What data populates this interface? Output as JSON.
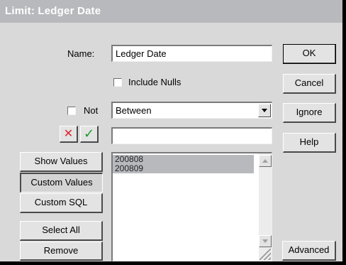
{
  "window": {
    "title": "Limit: Ledger Date"
  },
  "form": {
    "name_label": "Name:",
    "name_value": "Ledger Date",
    "include_nulls_label": "Include Nulls",
    "not_label": "Not",
    "operator_value": "Between",
    "value_input": ""
  },
  "icons": {
    "cancel_x": "✕",
    "accept_check": "✓"
  },
  "left_buttons": {
    "show_values": "Show Values",
    "custom_values": "Custom Values",
    "custom_sql": "Custom SQL",
    "select_all": "Select All",
    "remove": "Remove"
  },
  "right_buttons": {
    "ok": "OK",
    "cancel": "Cancel",
    "ignore": "Ignore",
    "help": "Help",
    "advanced": "Advanced"
  },
  "values_list": {
    "items": [
      "200808",
      "200809"
    ]
  },
  "colors": {
    "title_bar": "#b8b9bd",
    "dialog_bg": "#d9d9d9",
    "red_x": "#e0202a",
    "green_check": "#1a9a2a",
    "selected_item": "#b8b9bd"
  }
}
